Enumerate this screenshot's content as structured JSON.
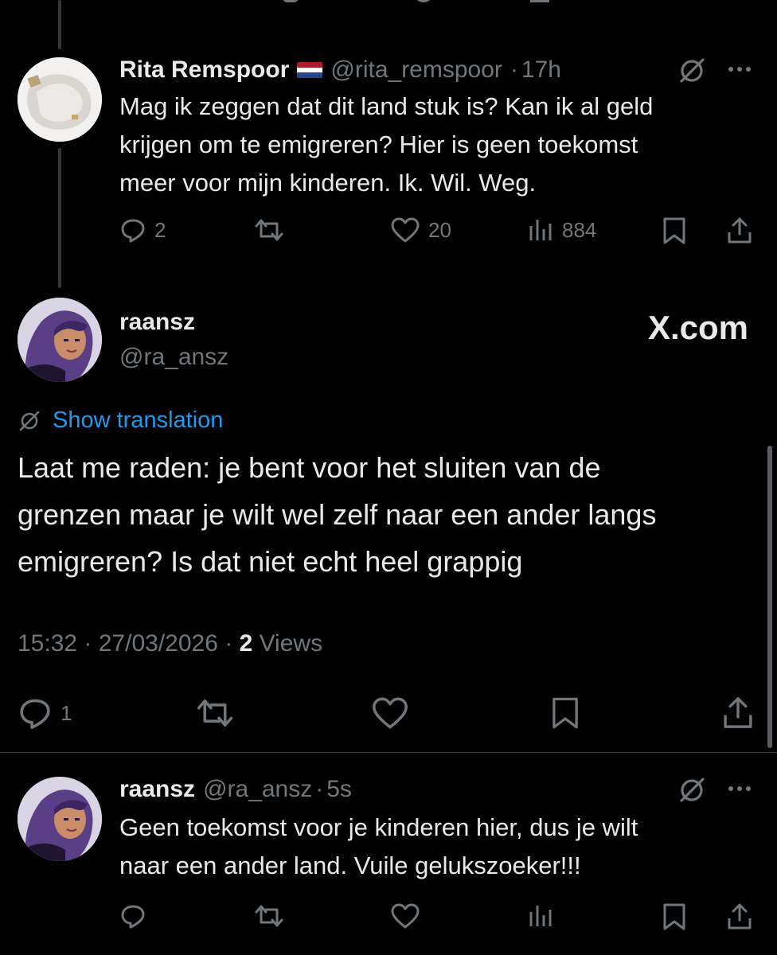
{
  "posts": {
    "rita": {
      "name": "Rita Remspoor",
      "flag": "🇳🇱",
      "handle": "@rita_remspoor",
      "sep": "·",
      "time": "17h",
      "text": "Mag ik zeggen dat dit land stuk is?  Kan ik al geld\nkrijgen om te emigreren? Hier is geen toekomst\nmeer voor mijn kinderen. Ik. Wil. Weg.",
      "replies": "2",
      "likes": "20",
      "views": "884"
    },
    "main": {
      "name": "raansz",
      "handle": "@ra_ansz",
      "watermark": "X.com",
      "translation_link": "Show translation",
      "text": "Laat me raden: je bent voor het sluiten van de\ngrenzen maar je wilt wel zelf naar een ander langs\nemigreren? Is dat niet echt heel grappig",
      "timestamp": "15:32 · 27/03/2026 ·",
      "views_count": "2",
      "views_label": "Views",
      "replies": "1"
    },
    "reply": {
      "name": "raansz",
      "handle": "@ra_ansz",
      "sep": "·",
      "time": "5s",
      "text": "Geen toekomst voor je kinderen hier, dus je wilt\nnaar een ander land. Vuile gelukszoeker!!!"
    }
  },
  "colors": {
    "background": "#000000",
    "text": "#e7e9ea",
    "muted": "#71767b",
    "link": "#1d9bf0",
    "divider": "#2f3336"
  }
}
